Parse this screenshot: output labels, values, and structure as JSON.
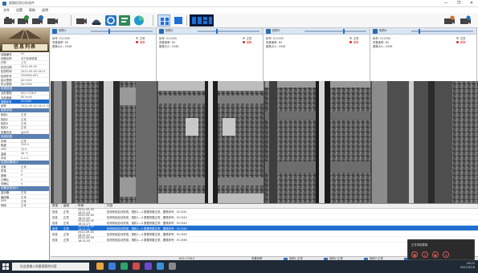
{
  "window": {
    "title": "图像检测分析软件",
    "controls": [
      "—",
      "❐",
      "✕"
    ]
  },
  "menu": [
    "文件",
    "设置",
    "帮助",
    "说明"
  ],
  "left_panel": {
    "title": "信息列表",
    "sections": [
      {
        "header": null,
        "rows": [
          {
            "k": "线路编号",
            "v": "01"
          },
          {
            "k": "线路名称",
            "v": "京沪高速铁路"
          },
          {
            "k": "行别",
            "v": "上行"
          },
          {
            "k": "检测日期",
            "v": "2022-09-16"
          },
          {
            "k": "检测时间",
            "v": "2022-09-16 16:21"
          },
          {
            "k": "检测车号",
            "v": "CRH380-001"
          },
          {
            "k": "起点里程",
            "v": "K0+000"
          },
          {
            "k": "终点里程",
            "v": "K0+000"
          }
        ]
      },
      {
        "header": "检测信息",
        "rows": [
          {
            "k": "当前里程",
            "v": "K01+236.5"
          },
          {
            "k": "当前速度",
            "v": "85 km/h",
            "hl": false
          },
          {
            "k": "图像序号",
            "v": "011345",
            "hl": true
          },
          {
            "k": "帧率",
            "v": "2022-09-16 16:21:31"
          }
        ]
      },
      {
        "header": "相机状态",
        "rows": [
          {
            "k": "相机1",
            "v": "正常"
          },
          {
            "k": "相机2",
            "v": "正常"
          },
          {
            "k": "相机3",
            "v": "正常"
          },
          {
            "k": "相机4",
            "v": "正常"
          },
          {
            "k": "采集状态",
            "v": "运行中"
          }
        ]
      },
      {
        "header": "系统信息",
        "rows": [
          {
            "k": "存储",
            "v": "正常"
          },
          {
            "k": "磁盘",
            "v": "326 G"
          },
          {
            "k": "CPU",
            "v": "32%"
          },
          {
            "k": "温度",
            "v": "46 ℃"
          },
          {
            "k": "内存",
            "v": "4.2 G"
          }
        ]
      },
      {
        "header": "检测结果统计",
        "rows": [
          {
            "k": "总数",
            "v": "正常"
          },
          {
            "k": "异常",
            "v": "0"
          },
          {
            "k": "报警",
            "v": "0"
          },
          {
            "k": "已确认",
            "v": "0"
          },
          {
            "k": "未确认",
            "v": "0"
          }
        ]
      },
      {
        "header": "设备状态统计",
        "rows": [
          {
            "k": "激光器",
            "v": "正常"
          },
          {
            "k": "编码器",
            "v": "正常"
          },
          {
            "k": "GPS",
            "v": "正常"
          },
          {
            "k": "网络",
            "v": "正常"
          }
        ]
      }
    ]
  },
  "cameras": [
    {
      "label": "相机1",
      "lines": [
        "帧号: 011345",
        "采集速率: 85",
        "图像大小: 2048"
      ],
      "status": [
        "正常",
        "报警"
      ]
    },
    {
      "label": "相机2",
      "lines": [
        "帧号: 011345",
        "采集速率: 85",
        "图像大小: 2048"
      ],
      "status": [
        "正常",
        "报警"
      ]
    },
    {
      "label": "相机3",
      "lines": [
        "帧号: 011345",
        "采集速率: 85",
        "图像大小: 2048"
      ],
      "status": [
        "正常",
        "报警"
      ]
    },
    {
      "label": "相机4",
      "lines": [
        "帧号: 011345",
        "采集速率: 85",
        "图像大小: 2048"
      ],
      "status": [
        "正常",
        "报警"
      ]
    }
  ],
  "log": {
    "headers": [
      "类型",
      "级别",
      "时间",
      "内容"
    ],
    "rows": [
      {
        "type": "信息",
        "level": "正常",
        "time": "2022-09-16 16:21:23",
        "msg": "检测系统启动完成，相机1—4 数据采集正常，图像序号：011341"
      },
      {
        "type": "信息",
        "level": "正常",
        "time": "2022-09-16 16:21:25",
        "msg": "检测系统启动完成，相机1—4 数据采集正常，图像序号：011342"
      },
      {
        "type": "信息",
        "level": "正常",
        "time": "2022-09-16 16:21:27",
        "msg": "检测系统启动完成，相机1—4 数据采集正常，图像序号：011343"
      },
      {
        "type": "信息",
        "level": "正常",
        "time": "2022-09-16 16:21:29",
        "msg": "检测系统启动完成，相机1—4 数据采集正常，图像序号：011344",
        "sel": true
      },
      {
        "type": "信息",
        "level": "正常",
        "time": "2022-09-16 16:21:31",
        "msg": "检测系统启动完成，相机1—4 数据采集正常，图像序号：011345"
      },
      {
        "type": "信息",
        "level": "正常",
        "time": "2022-09-16 16:21:33",
        "msg": "检测系统启动完成，相机1—4 数据采集正常，图像序号：011346"
      }
    ]
  },
  "status_bar": [
    "K01+236.5",
    "采集帧率",
    "相机1 正常",
    "相机2 正常",
    "相机3 正常",
    "相机4 正常",
    "2022-09-16"
  ],
  "toast": {
    "title": "正在录制屏幕"
  },
  "taskbar": {
    "search_placeholder": "在这里输入你要搜索的内容",
    "time": "16:21",
    "date": "2022/9/16"
  },
  "colors": {
    "accent": "#1f6fd1",
    "alarm": "#d62a2a",
    "ok": "#b0b0b0"
  }
}
